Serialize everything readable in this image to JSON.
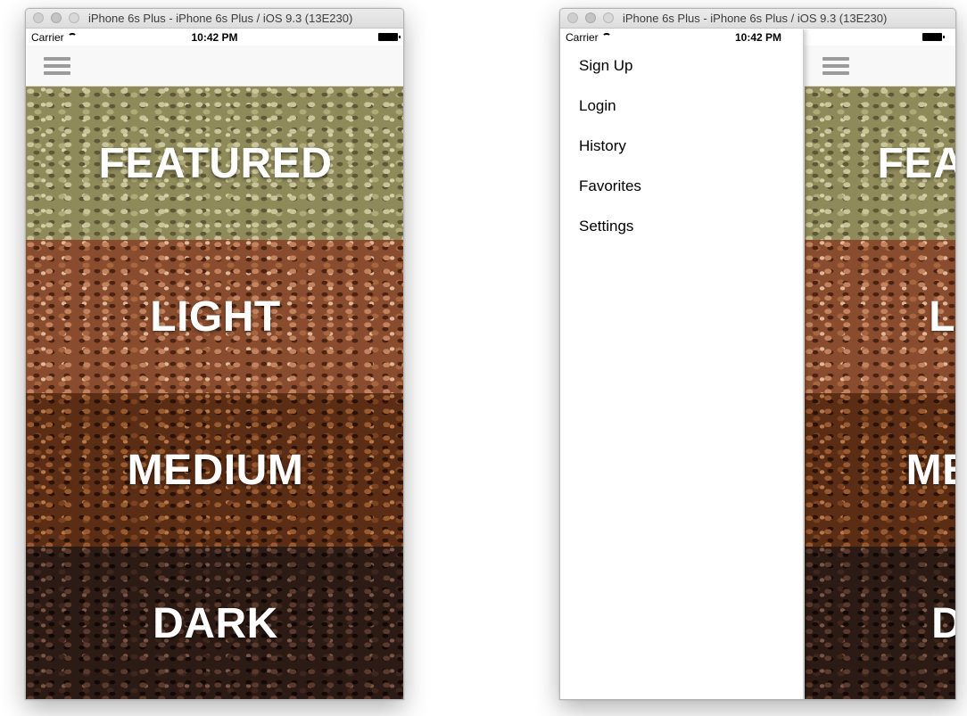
{
  "simulator": {
    "title": "iPhone 6s Plus - iPhone 6s Plus / iOS 9.3 (13E230)"
  },
  "status_bar": {
    "carrier": "Carrier",
    "time": "10:42 PM"
  },
  "navbar": {
    "menu_icon": "hamburger-menu-icon"
  },
  "categories": [
    {
      "label": "FEATURED"
    },
    {
      "label": "LIGHT"
    },
    {
      "label": "MEDIUM"
    },
    {
      "label": "DARK"
    }
  ],
  "side_menu": {
    "items": [
      {
        "label": "Sign Up"
      },
      {
        "label": "Login"
      },
      {
        "label": "History"
      },
      {
        "label": "Favorites"
      },
      {
        "label": "Settings"
      }
    ]
  },
  "colors": {
    "tile_label": "#ffffff",
    "navbar_background": "#f8f8f8",
    "menu_icon": "#9b9b9b"
  }
}
